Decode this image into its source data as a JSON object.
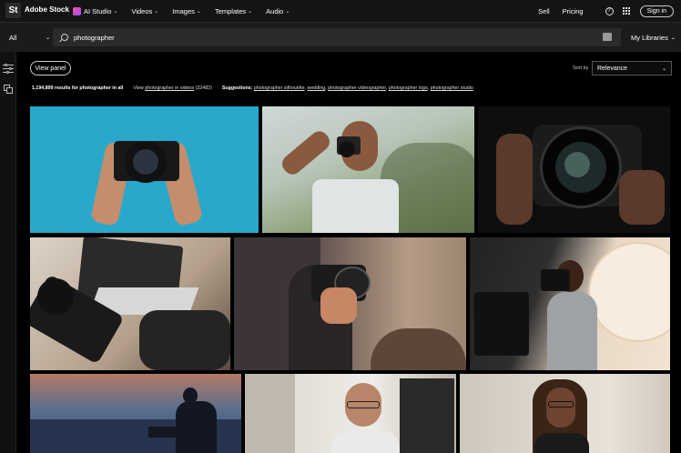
{
  "header": {
    "logo_badge": "St",
    "logo_text": "Adobe Stock",
    "nav": [
      {
        "label": "AI Studio",
        "icon": "ai-studio-icon"
      },
      {
        "label": "Videos"
      },
      {
        "label": "Images"
      },
      {
        "label": "Templates"
      },
      {
        "label": "Audio"
      }
    ],
    "sell": "Sell",
    "pricing": "Pricing",
    "help_icon": "?",
    "signin": "Sign in"
  },
  "search": {
    "scope": "All",
    "query": "photographer",
    "libraries": "My Libraries"
  },
  "controls": {
    "view_panel": "View panel",
    "sort_label": "Sort by",
    "sort_value": "Relevance"
  },
  "results": {
    "count_text": "1,194,899 results for photographer in all",
    "view_prefix": "View",
    "videos_link": "photographer in videos",
    "videos_count": "(32482)",
    "suggestions_label": "Suggestions:",
    "suggestions": [
      "photographer silhouette",
      "wedding",
      "photographer videographer",
      "photographer logo",
      "photographer studio"
    ]
  },
  "photos": [
    {
      "name": "hands-holding-camera-blue"
    },
    {
      "name": "man-shooting-park"
    },
    {
      "name": "lens-closeup-dark"
    },
    {
      "name": "camera-laptop-desk"
    },
    {
      "name": "photographer-sunset-hills"
    },
    {
      "name": "woman-studio-umbrella"
    },
    {
      "name": "silhouette-tripod-dusk"
    },
    {
      "name": "woman-glasses-studio"
    },
    {
      "name": "woman-braids-smiling"
    }
  ],
  "colors": {
    "accent_ai": "#c24dff",
    "background": "#000000"
  }
}
